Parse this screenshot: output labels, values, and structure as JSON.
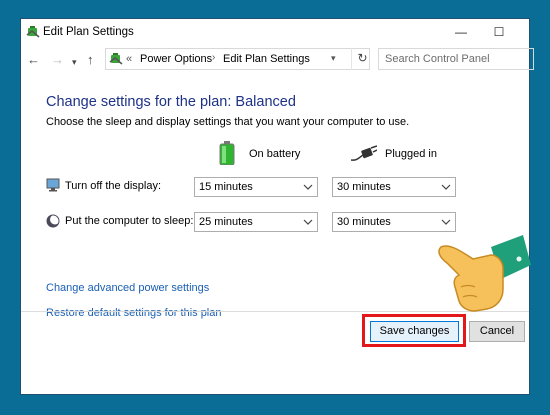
{
  "window": {
    "title": "Edit Plan Settings",
    "controls": {
      "minimize": "—",
      "maximize": "☐"
    }
  },
  "address": {
    "path": [
      "Power Options",
      "Edit Plan Settings"
    ],
    "overflow": "«",
    "search_placeholder": "Search Control Panel"
  },
  "main": {
    "heading": "Change settings for the plan: Balanced",
    "description": "Choose the sleep and display settings that you want your computer to use.",
    "columns": {
      "battery": "On battery",
      "plugged": "Plugged in"
    },
    "rows": [
      {
        "label": "Turn off the display:",
        "battery": "15 minutes",
        "plugged": "30 minutes",
        "icon": "display-icon"
      },
      {
        "label": "Put the computer to sleep:",
        "battery": "25 minutes",
        "plugged": "30 minutes",
        "icon": "sleep-icon"
      }
    ],
    "links": {
      "advanced": "Change advanced power settings",
      "restore": "Restore default settings for this plan"
    }
  },
  "buttons": {
    "save": "Save changes",
    "cancel": "Cancel"
  },
  "colors": {
    "background": "#0a6d95",
    "heading": "#1e3287",
    "link": "#1a5fb4",
    "highlight": "#e3181b",
    "accent": "#0078d7"
  }
}
